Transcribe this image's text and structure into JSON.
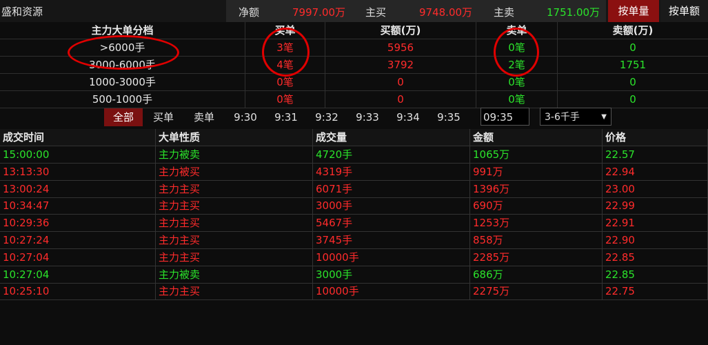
{
  "stock": {
    "name": "盛和资源"
  },
  "summary": {
    "net_label": "净额",
    "net_value": "7997.00万",
    "buy_label": "主买",
    "buy_value": "9748.00万",
    "sell_label": "主卖",
    "sell_value": "1751.00万"
  },
  "mode_buttons": {
    "by_volume": "按单量",
    "by_amount": "按单额"
  },
  "size_table": {
    "headers": [
      "主力大单分档",
      "买单",
      "买额(万)",
      "卖单",
      "卖额(万)"
    ],
    "rows": [
      {
        "tier": ">6000手",
        "buy_count": "3笔",
        "buy_amount": "5956",
        "sell_count": "0笔",
        "sell_amount": "0"
      },
      {
        "tier": "3000-6000手",
        "buy_count": "4笔",
        "buy_amount": "3792",
        "sell_count": "2笔",
        "sell_amount": "1751"
      },
      {
        "tier": "1000-3000手",
        "buy_count": "0笔",
        "buy_amount": "0",
        "sell_count": "0笔",
        "sell_amount": "0"
      },
      {
        "tier": "500-1000手",
        "buy_count": "0笔",
        "buy_amount": "0",
        "sell_count": "0笔",
        "sell_amount": "0"
      }
    ]
  },
  "filters": {
    "tabs": [
      "全部",
      "买单",
      "卖单",
      "9:30",
      "9:31",
      "9:32",
      "9:33",
      "9:34",
      "9:35"
    ],
    "time_input": "09:35",
    "range_select": "3-6千手"
  },
  "trade_table": {
    "headers": [
      "成交时间",
      "大单性质",
      "成交量",
      "金额",
      "价格"
    ],
    "rows": [
      {
        "time": "15:00:00",
        "type": "主力被卖",
        "volume": "4720手",
        "amount": "1065万",
        "price": "22.57",
        "color": "green"
      },
      {
        "time": "13:13:30",
        "type": "主力被买",
        "volume": "4319手",
        "amount": "991万",
        "price": "22.94",
        "color": "red"
      },
      {
        "time": "13:00:24",
        "type": "主力主买",
        "volume": "6071手",
        "amount": "1396万",
        "price": "23.00",
        "color": "red"
      },
      {
        "time": "10:34:47",
        "type": "主力主买",
        "volume": "3000手",
        "amount": "690万",
        "price": "22.99",
        "color": "red"
      },
      {
        "time": "10:29:36",
        "type": "主力主买",
        "volume": "5467手",
        "amount": "1253万",
        "price": "22.91",
        "color": "red"
      },
      {
        "time": "10:27:24",
        "type": "主力主买",
        "volume": "3745手",
        "amount": "858万",
        "price": "22.90",
        "color": "red"
      },
      {
        "time": "10:27:04",
        "type": "主力主买",
        "volume": "10000手",
        "amount": "2285万",
        "price": "22.85",
        "color": "red"
      },
      {
        "time": "10:27:04",
        "type": "主力被卖",
        "volume": "3000手",
        "amount": "686万",
        "price": "22.85",
        "color": "green"
      },
      {
        "time": "10:25:10",
        "type": "主力主买",
        "volume": "10000手",
        "amount": "2275万",
        "price": "22.75",
        "color": "red"
      }
    ]
  },
  "colors": {
    "up": "#ff2b2b",
    "down": "#2be32b",
    "accent": "#8b1010",
    "annotation": "#e00000"
  }
}
